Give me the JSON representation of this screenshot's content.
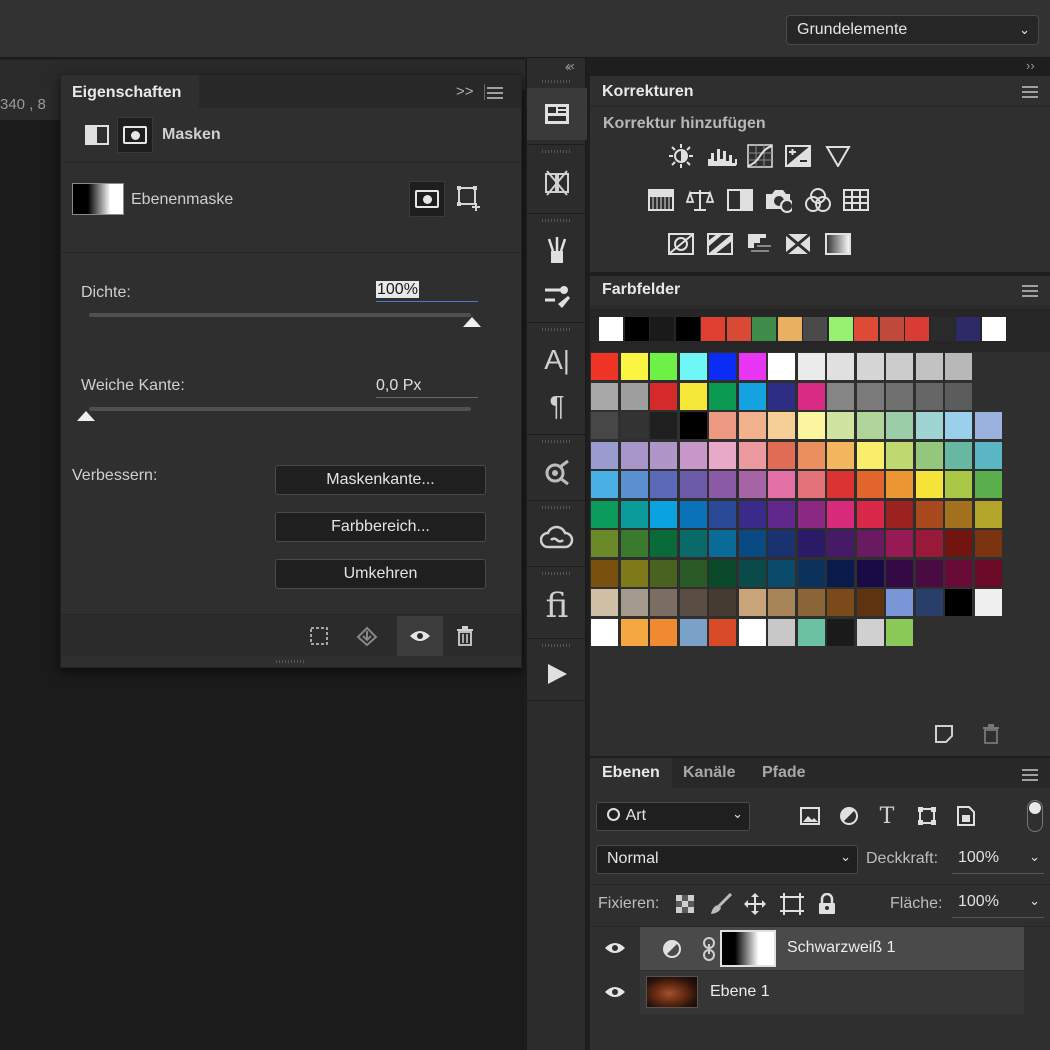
{
  "header": {
    "workspace": "Grundelemente"
  },
  "ruler": {
    "text": "340 , 8"
  },
  "properties": {
    "tab": "Eigenschaften",
    "section": "Masken",
    "mask_label": "Ebenenmaske",
    "density_label": "Dichte:",
    "density_value": "100%",
    "feather_label": "Weiche Kante:",
    "feather_value": "0,0 Px",
    "refine_label": "Verbessern:",
    "buttons": {
      "mask_edge": "Maskenkante...",
      "color_range": "Farbbereich...",
      "invert": "Umkehren"
    }
  },
  "korrekturen": {
    "tab": "Korrekturen",
    "subtitle": "Korrektur hinzufügen"
  },
  "farbfelder": {
    "tab": "Farbfelder",
    "recent": [
      "#ffffff",
      "#000000",
      "#1a1a1a",
      "#000000",
      "#e04030",
      "#d84a34",
      "#3f8c4a",
      "#e8b060",
      "#4a4a4a",
      "#98f070",
      "#de4a36",
      "#c04a3c",
      "#d83c34",
      "#2a2a2a",
      "#2e2a68",
      "#ffffff"
    ],
    "grid": [
      [
        "#ef3324",
        "#f9f542",
        "#6ff046",
        "#6ff7f8",
        "#0a2cf5",
        "#e835f4",
        "#ffffff",
        "#ebebeb",
        "#e0e0e0",
        "#d6d6d6",
        "#cccccc",
        "#c2c2c2",
        "#b8b8b8"
      ],
      [
        "#a8a8a8",
        "#9e9e9e",
        "#d42a2a",
        "#f6e838",
        "#0a9a52",
        "#14a2e0",
        "#2e2d86",
        "#d82a82",
        "#858585",
        "#7a7a7a",
        "#707070",
        "#666666",
        "#5c5c5c"
      ],
      [
        "#474747",
        "#333333",
        "#1f1f1f",
        "#000000",
        "#ec9b82",
        "#f0b18c",
        "#f5cf95",
        "#fbf5a0",
        "#d0e3a0",
        "#b0d59a",
        "#9acda8",
        "#9ed4d2",
        "#9ad0ec",
        "#9cb2de"
      ],
      [
        "#9a9cd0",
        "#a896c8",
        "#b096c8",
        "#c896c8",
        "#e8a8c8",
        "#ec9aa0",
        "#e26d57",
        "#eb8f5e",
        "#f2b65e",
        "#f9ee6a",
        "#c0d870",
        "#94c77c",
        "#66b8a2",
        "#5ab6c2"
      ],
      [
        "#4ab0e4",
        "#5a8fd0",
        "#5a6ab8",
        "#6a5aa8",
        "#8a5aa6",
        "#a664a6",
        "#e470a8",
        "#e2727a",
        "#da3332",
        "#e2652e",
        "#eb9632",
        "#f7e43a",
        "#a8c846",
        "#5aae4c"
      ],
      [
        "#0a9a5a",
        "#0a9a9a",
        "#0aa2e0",
        "#0a72b8",
        "#2a4a98",
        "#3a2a8a",
        "#60288a",
        "#8a2882",
        "#d82a7a",
        "#d82a48",
        "#9c2220",
        "#a8491e",
        "#a4721e",
        "#b4a62a"
      ],
      [
        "#6a8a2a",
        "#3a7a2e",
        "#0a6a3a",
        "#0a6a6a",
        "#0a6a98",
        "#0a4a82",
        "#1a3270",
        "#2a1a68",
        "#461a66",
        "#6a1a60",
        "#981a54",
        "#981a38",
        "#721410",
        "#7a3510"
      ],
      [
        "#7a5210",
        "#7e7a1a",
        "#4a6220",
        "#2a5a26",
        "#0a4a2a",
        "#0a4a4a",
        "#0a4a6a",
        "#0a325a",
        "#0a1a4a",
        "#1a0a46",
        "#340a44",
        "#4a0a42",
        "#6a0a38",
        "#6a0a26"
      ],
      [
        "#cfbfa5",
        "#a3998c",
        "#7a6e62",
        "#5a4e44",
        "#443a32",
        "#c9a47a",
        "#a88558",
        "#8a6638",
        "#7a4a1a",
        "#5e3410",
        "#7a96d6",
        "#2a3e6a",
        "#000000",
        "#f0f0f0"
      ],
      [
        "#ffffff",
        "#f5a842",
        "#f08a32",
        "#7aa2c8",
        "#d84a28",
        "#ffffff",
        "#c8c8c8",
        "#6ac2a2",
        "#1a1a1a",
        "#d0d0d0",
        "#8ac858"
      ]
    ]
  },
  "ebenen": {
    "tabs": [
      "Ebenen",
      "Kanäle",
      "Pfade"
    ],
    "filter": "Art",
    "blend_mode": "Normal",
    "opacity_label": "Deckkraft:",
    "opacity_value": "100%",
    "lock_label": "Fixieren:",
    "fill_label": "Fläche:",
    "fill_value": "100%",
    "layers": [
      {
        "name": "Schwarzweiß 1"
      },
      {
        "name": "Ebene 1"
      }
    ]
  }
}
